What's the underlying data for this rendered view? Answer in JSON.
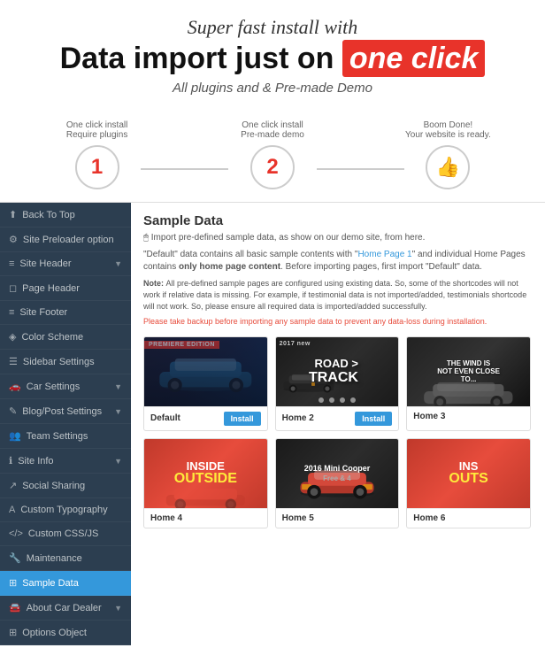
{
  "header": {
    "super_fast": "Super fast install with",
    "main_title_part1": "Data import just on",
    "main_title_highlight": "one click",
    "subtitle": "All plugins and & Pre-made Demo"
  },
  "steps": [
    {
      "label": "One click install",
      "sub": "Require plugins",
      "type": "number",
      "value": "1"
    },
    {
      "label": "One click install",
      "sub": "Pre-made demo",
      "type": "number",
      "value": "2"
    },
    {
      "label": "Boom Done!",
      "sub": "Your website is ready.",
      "type": "icon",
      "value": "👍"
    }
  ],
  "sidebar": {
    "items": [
      {
        "label": "Back To Top",
        "icon": "⬆",
        "active": false
      },
      {
        "label": "Site Preloader option",
        "icon": "⚙",
        "active": false
      },
      {
        "label": "Site Header",
        "icon": "▤",
        "arrow": true,
        "active": false
      },
      {
        "label": "Page Header",
        "icon": "📄",
        "active": false
      },
      {
        "label": "Site Footer",
        "icon": "▤",
        "active": false
      },
      {
        "label": "Color Scheme",
        "icon": "🎨",
        "active": false
      },
      {
        "label": "Sidebar Settings",
        "icon": "☰",
        "active": false
      },
      {
        "label": "Car Settings",
        "icon": "🚗",
        "arrow": true,
        "active": false
      },
      {
        "label": "Blog/Post Settings",
        "icon": "📝",
        "arrow": true,
        "active": false
      },
      {
        "label": "Team Settings",
        "icon": "👥",
        "active": false
      },
      {
        "label": "Site Info",
        "icon": "ℹ",
        "arrow": true,
        "active": false
      },
      {
        "label": "Social Sharing",
        "icon": "↗",
        "active": false
      },
      {
        "label": "Custom Typography",
        "icon": "T",
        "active": false
      },
      {
        "label": "Custom CSS/JS",
        "icon": "</>",
        "active": false
      },
      {
        "label": "Maintenance",
        "icon": "🔧",
        "active": false
      },
      {
        "label": "Sample Data",
        "icon": "⊞",
        "active": true
      },
      {
        "label": "About Car Dealer",
        "icon": "🚘",
        "arrow": true,
        "active": false
      },
      {
        "label": "Options Object",
        "icon": "⊞",
        "active": false
      }
    ]
  },
  "content": {
    "title": "Sample Data",
    "description": "Import pre-defined sample data, as show on our demo site, from here.",
    "note_prefix": "\"Default\" data contains all basic sample contents with \"",
    "note_homepage": "Home Page 1",
    "note_middle": "\" and individual Home Pages contains",
    "note_only": "only home page content",
    "note_suffix": ". Before importing pages, first import \"Default\" data.",
    "note_label": "Note:",
    "note_body": "All pre-defined sample pages are configured using existing data. So, some of the shortcodes will not work if relative data is missing. For example, if testimonial data is not imported/added, testimonials shortcode will not work. So, please ensure all required data is imported/added successfully.",
    "warning": "Please take backup before importing any sample data to prevent any data-loss during installation.",
    "demos": [
      {
        "id": "default",
        "name": "Default",
        "theme": "default",
        "has_install": true,
        "overlay_text": "PREMIERE EDITION"
      },
      {
        "id": "home2",
        "name": "Home 2",
        "theme": "home2",
        "has_install": true,
        "overlay_text": "ROAD > TRACK"
      },
      {
        "id": "home3",
        "name": "Home 3",
        "theme": "home3",
        "has_install": false,
        "overlay_text": "THE WIND IS NOT EVEN CLOSE TO..."
      },
      {
        "id": "home4",
        "name": "Home 4",
        "theme": "home4",
        "has_install": false,
        "overlay_text": "INSIDE OUTSIDE"
      },
      {
        "id": "home5",
        "name": "Home 5",
        "theme": "home5",
        "has_install": false,
        "overlay_text": "2016 Mini Cooper"
      },
      {
        "id": "home6",
        "name": "Home 6",
        "theme": "home6",
        "has_install": false,
        "overlay_text": "INSIDE OUTSIDE"
      }
    ],
    "install_label": "Install"
  }
}
